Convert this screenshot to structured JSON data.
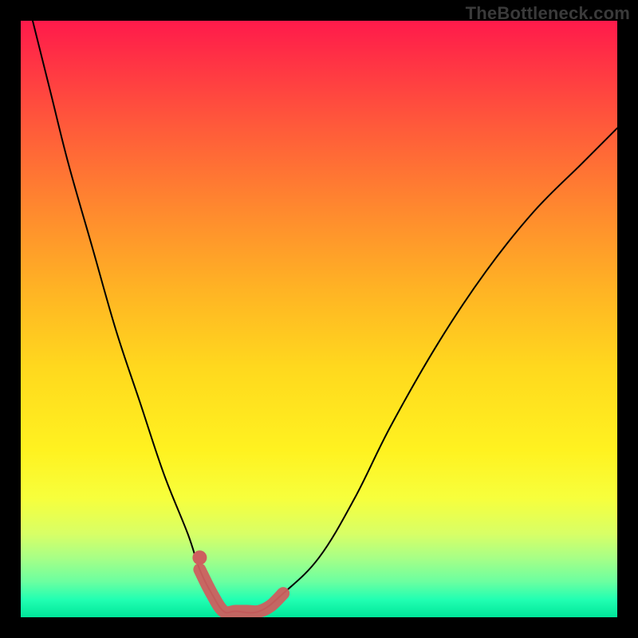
{
  "watermark": "TheBottleneck.com",
  "colors": {
    "frame_bg": "#000000",
    "watermark_text": "#3a3a3a",
    "curve_stroke": "#000000",
    "trough_stroke": "#cd5f5f",
    "gradient_top": "#ff1a4b",
    "gradient_bottom": "#00e69a"
  },
  "chart_data": {
    "type": "line",
    "title": "",
    "xlabel": "",
    "ylabel": "",
    "xlim": [
      0,
      100
    ],
    "ylim": [
      0,
      100
    ],
    "note": "Axes are unlabeled; values are normalized 0–100 estimated from pixel position. y=0 is bottom, y=100 is top. Background is a vertical heat gradient from red (top) to green (bottom).",
    "series": [
      {
        "name": "bottleneck-curve",
        "x": [
          2,
          5,
          8,
          12,
          16,
          20,
          24,
          28,
          30,
          32,
          34,
          36,
          40,
          44,
          50,
          56,
          62,
          70,
          78,
          86,
          94,
          100
        ],
        "y": [
          100,
          88,
          76,
          62,
          48,
          36,
          24,
          14,
          8,
          4,
          1,
          1,
          1,
          4,
          10,
          20,
          32,
          46,
          58,
          68,
          76,
          82
        ]
      },
      {
        "name": "trough-highlight",
        "x": [
          30,
          32,
          34,
          36,
          38,
          40,
          42,
          44
        ],
        "y": [
          8,
          4,
          1,
          1,
          1,
          1,
          2,
          4
        ]
      }
    ],
    "marker": {
      "name": "trough-dot",
      "x": 30,
      "y": 10
    }
  }
}
